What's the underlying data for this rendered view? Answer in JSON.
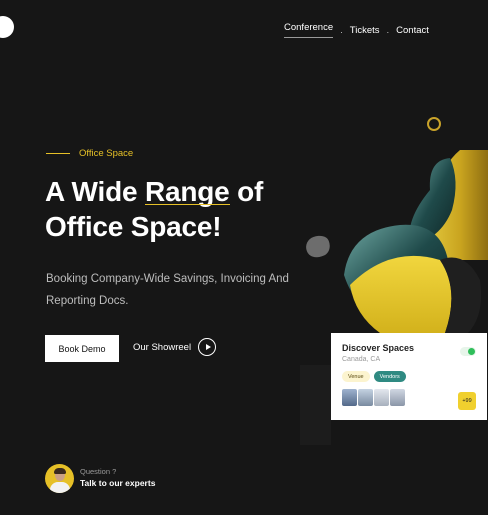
{
  "nav": {
    "items": [
      {
        "label": "Conference",
        "active": true
      },
      {
        "label": "Tickets",
        "active": false
      },
      {
        "label": "Contact",
        "active": false
      }
    ],
    "separator": "."
  },
  "hero": {
    "eyebrow": "Office Space",
    "headline_pre": "A Wide ",
    "headline_highlight": "Range",
    "headline_post": " of",
    "headline_line2": "Office Space!",
    "subtitle": "Booking Company-Wide Savings, Invoicing And Reporting Docs.",
    "book_demo_label": "Book Demo",
    "showreel_label": "Our Showreel"
  },
  "expert": {
    "question": "Question ?",
    "cta": "Talk to our experts"
  },
  "card": {
    "title": "Discover Spaces",
    "location": "Canada, CA",
    "tags": [
      "Venue",
      "Vendors"
    ],
    "more_count": "+99",
    "toggle_on": true
  },
  "colors": {
    "background": "#161616",
    "accent": "#e6c027",
    "teal": "#2f8a82",
    "toggle_green": "#2fbe5a"
  },
  "icons": {
    "play": "play-icon",
    "toggle": "toggle-switch-icon"
  }
}
